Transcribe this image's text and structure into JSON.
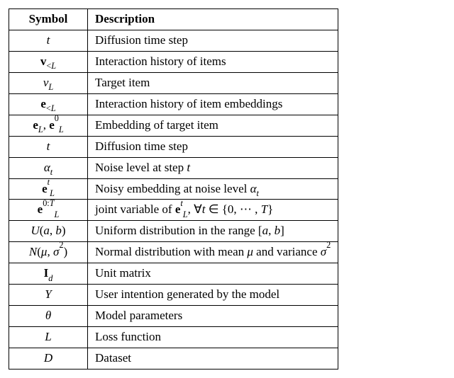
{
  "headers": {
    "symbol": "Symbol",
    "description": "Description"
  },
  "rows": [
    {
      "symbol_html": "<span class='it'>t</span>",
      "desc": "Diffusion time step"
    },
    {
      "symbol_html": "<span class='bf'>v</span><sub>&lt;<span class='it'>L</span></sub>",
      "desc": "Interaction history of items"
    },
    {
      "symbol_html": "<span class='it'>v</span><sub><span class='it'>L</span></sub>",
      "desc": "Target item"
    },
    {
      "symbol_html": "<span class='bf'>e</span><sub>&lt;<span class='it'>L</span></sub>",
      "desc": "Interaction history of item embeddings"
    },
    {
      "symbol_html": "<span class='bf'>e</span><sub><span class='it'>L</span></sub>, <span class='bf'>e</span><sup>0</sup><sub><span class='it'>L</span></sub>",
      "desc": "Embedding of target item"
    },
    {
      "symbol_html": "<span class='it'>t</span>",
      "desc": "Diffusion time step"
    },
    {
      "symbol_html": "<span class='it'>α</span><sub><span class='it'>t</span></sub>",
      "desc_html": "Noise level at step <span class='it'>t</span>"
    },
    {
      "symbol_html": "<span class='bf'>e</span><sup><span class='it'>t</span></sup><sub><span class='it'>L</span></sub>",
      "desc_html": "Noisy embedding at noise level <span class='it'>α</span><sub><span class='it'>t</span></sub>"
    },
    {
      "symbol_html": "<span class='bf'>e</span><sup>0:<span class='it'>T</span></sup><sub><span class='it'>L</span></sub>",
      "desc_html": "joint variable of <span class='bf'>e</span><sup><span class='it'>t</span></sup><sub><span class='it'>L</span></sub>, ∀<span class='it'>t</span> ∈ {0, ⋯ , <span class='it'>T</span>}"
    },
    {
      "symbol_html": "<span class='cal'>U</span>(<span class='it'>a</span>, <span class='it'>b</span>)",
      "desc_html": "Uniform distribution in the range [<span class='it'>a</span>, <span class='it'>b</span>]"
    },
    {
      "symbol_html": "<span class='cal'>N</span>(<span class='it'>μ</span>, <span class='it'>σ</span><sup>2</sup>)",
      "desc_html": "Normal distribution with mean <span class='it'>μ</span> and variance <span class='it'>σ</span><sup>2</sup>"
    },
    {
      "symbol_html": "<span class='bf'>I</span><sub><span class='it'>d</span></sub>",
      "desc": "Unit matrix"
    },
    {
      "symbol_html": "<span class='cal'>Y</span>",
      "desc": "User intention generated by the model"
    },
    {
      "symbol_html": "<span class='it'>θ</span>",
      "desc": "Model parameters"
    },
    {
      "symbol_html": "<span class='cal'>L</span>",
      "desc": "Loss function"
    },
    {
      "symbol_html": "<span class='cal'>D</span>",
      "desc": "Dataset"
    }
  ]
}
